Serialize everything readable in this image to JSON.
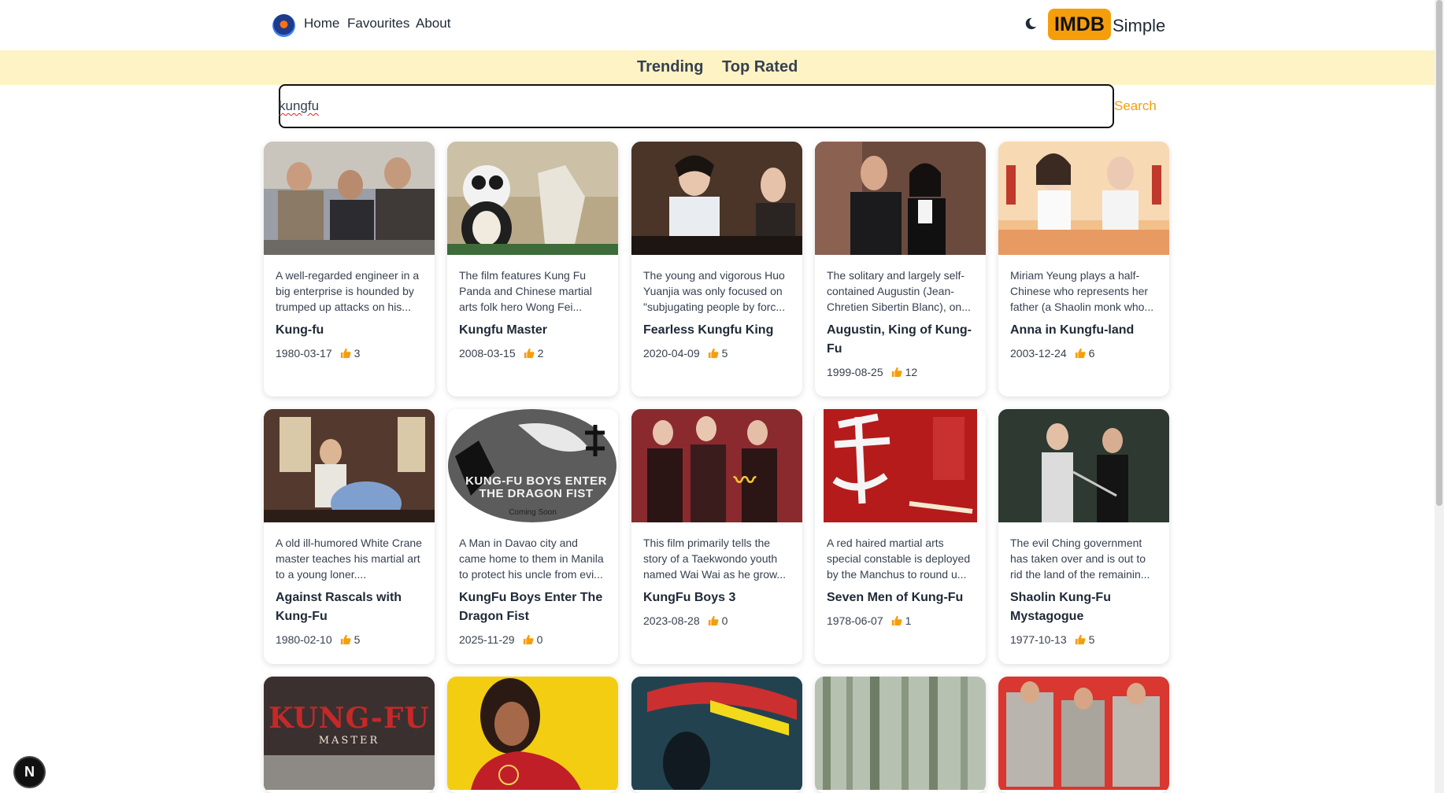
{
  "nav": {
    "logo_icon": "app-logo-icon",
    "links": [
      "Home",
      "Favourites",
      "About"
    ],
    "theme_icon": "moon-icon",
    "brand_badge": "IMDB",
    "brand_text": "Simple"
  },
  "tabs": [
    "Trending",
    "Top Rated"
  ],
  "search": {
    "value": "kungfu",
    "button": "Search"
  },
  "colors": {
    "accent": "#f59e0b",
    "tabs_bg": "#fdf3c4",
    "thumb": "#f59e0b"
  },
  "movies": [
    {
      "overview": "A well-regarded engineer in a big enterprise is hounded by trumped up attacks on his...",
      "title": "Kung-fu",
      "date": "1980-03-17",
      "likes": "3"
    },
    {
      "overview": "The film features Kung Fu Panda and Chinese martial arts folk hero Wong Fei...",
      "title": "Kungfu Master",
      "date": "2008-03-15",
      "likes": "2"
    },
    {
      "overview": "The young and vigorous Huo Yuanjia was only focused on \"subjugating people by forc...",
      "title": "Fearless Kungfu King",
      "date": "2020-04-09",
      "likes": "5"
    },
    {
      "overview": "The solitary and largely self-contained Augustin (Jean-Chretien Sibertin Blanc), on...",
      "title": "Augustin, King of Kung-Fu",
      "date": "1999-08-25",
      "likes": "12"
    },
    {
      "overview": "Miriam Yeung plays a half-Chinese who represents her father (a Shaolin monk who...",
      "title": "Anna in Kungfu-land",
      "date": "2003-12-24",
      "likes": "6"
    },
    {
      "overview": "A old ill-humored White Crane master teaches his martial art to a young loner....",
      "title": "Against Rascals with Kung-Fu",
      "date": "1980-02-10",
      "likes": "5"
    },
    {
      "overview": "A Man in Davao city and came home to them in Manila to protect his uncle from evi...",
      "title": "KungFu Boys Enter The Dragon Fist",
      "date": "2025-11-29",
      "likes": "0"
    },
    {
      "overview": "This film primarily tells the story of a Taekwondo youth named Wai Wai as he grow...",
      "title": "KungFu Boys 3",
      "date": "2023-08-28",
      "likes": "0"
    },
    {
      "overview": "A red haired martial arts special constable is deployed by the Manchus to round u...",
      "title": "Seven Men of Kung-Fu",
      "date": "1978-06-07",
      "likes": "1"
    },
    {
      "overview": "The evil Ching government has taken over and is out to rid the land of the remainin...",
      "title": "Shaolin Kung-Fu Mystagogue",
      "date": "1977-10-13",
      "likes": "5"
    }
  ],
  "posters": {
    "poster_6_text": "KUNG-FU BOYS ENTER THE DRAGON FIST",
    "poster_6_sub": "Coming Soon",
    "poster_10_text": "KUNG-FU",
    "poster_10_sub": "MASTER"
  },
  "badge": "N"
}
